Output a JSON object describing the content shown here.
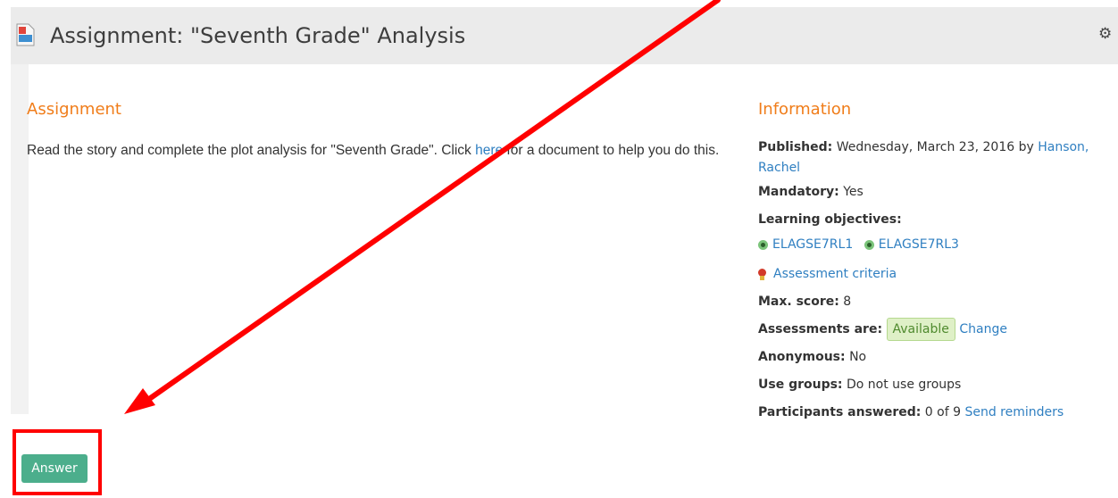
{
  "header": {
    "title": "Assignment: \"Seventh Grade\" Analysis",
    "icon": "document-icon",
    "settings_icon": "gear-icon"
  },
  "assignment": {
    "heading": "Assignment",
    "text_before": "Read the story and complete the plot analysis for \"Seventh Grade\".  Click ",
    "link": "here",
    "text_after": " for a document to help you do this."
  },
  "info": {
    "heading": "Information",
    "published_label": "Published:",
    "published_value": " Wednesday, March 23, 2016 by ",
    "published_author": "Hanson, Rachel",
    "mandatory_label": "Mandatory:",
    "mandatory_value": " Yes",
    "objectives_label": "Learning objectives:",
    "objectives": [
      "ELAGSE7RL1",
      "ELAGSE7RL3"
    ],
    "criteria_link": "Assessment criteria",
    "max_score_label": "Max. score:",
    "max_score_value": " 8",
    "assessments_label": "Assessments are:",
    "assessments_status": "Available",
    "change_link": "Change",
    "anonymous_label": "Anonymous:",
    "anonymous_value": " No",
    "groups_label": "Use groups:",
    "groups_value": " Do not use groups",
    "participants_label": "Participants answered:",
    "participants_value": " 0 of 9 ",
    "send_reminders": "Send reminders"
  },
  "actions": {
    "answer_label": "Answer"
  },
  "colors": {
    "heading": "#f07d1a",
    "link": "#2f7fc1",
    "answer_button": "#4cae8c",
    "annotation": "#ff0000"
  }
}
